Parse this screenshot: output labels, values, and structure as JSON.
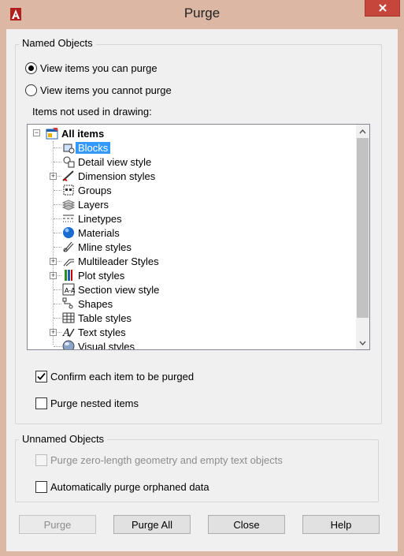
{
  "window": {
    "title": "Purge",
    "app_icon": "autocad-a-icon",
    "close_icon": "close-x-icon"
  },
  "named_objects": {
    "group_label": "Named Objects",
    "radio_can_purge": {
      "label": "View items you can purge",
      "selected": true
    },
    "radio_cannot_purge": {
      "label": "View items you cannot purge",
      "selected": false
    },
    "tree_label": "Items not used in drawing:",
    "tree": {
      "root": "All items",
      "items": [
        {
          "label": "Blocks",
          "icon": "blocks-icon",
          "expandable": false,
          "selected": true
        },
        {
          "label": "Detail view style",
          "icon": "detail-view-style-icon",
          "expandable": false,
          "selected": false
        },
        {
          "label": "Dimension styles",
          "icon": "dimension-styles-icon",
          "expandable": true,
          "selected": false
        },
        {
          "label": "Groups",
          "icon": "groups-icon",
          "expandable": false,
          "selected": false
        },
        {
          "label": "Layers",
          "icon": "layers-icon",
          "expandable": false,
          "selected": false
        },
        {
          "label": "Linetypes",
          "icon": "linetypes-icon",
          "expandable": false,
          "selected": false
        },
        {
          "label": "Materials",
          "icon": "materials-icon",
          "expandable": false,
          "selected": false
        },
        {
          "label": "Mline styles",
          "icon": "mline-styles-icon",
          "expandable": false,
          "selected": false
        },
        {
          "label": "Multileader Styles",
          "icon": "multileader-styles-icon",
          "expandable": true,
          "selected": false
        },
        {
          "label": "Plot styles",
          "icon": "plot-styles-icon",
          "expandable": true,
          "selected": false
        },
        {
          "label": "Section view style",
          "icon": "section-view-style-icon",
          "expandable": false,
          "selected": false
        },
        {
          "label": "Shapes",
          "icon": "shapes-icon",
          "expandable": false,
          "selected": false
        },
        {
          "label": "Table styles",
          "icon": "table-styles-icon",
          "expandable": false,
          "selected": false
        },
        {
          "label": "Text styles",
          "icon": "text-styles-icon",
          "expandable": true,
          "selected": false
        },
        {
          "label": "Visual styles",
          "icon": "visual-styles-icon",
          "expandable": false,
          "selected": false
        }
      ]
    },
    "confirm_each": {
      "label": "Confirm each item to be purged",
      "checked": true
    },
    "purge_nested": {
      "label": "Purge nested items",
      "checked": false
    }
  },
  "unnamed_objects": {
    "group_label": "Unnamed Objects",
    "zero_length": {
      "label": "Purge zero-length geometry and empty text objects",
      "checked": false,
      "enabled": false
    },
    "orphaned": {
      "label": "Automatically purge orphaned data",
      "checked": false
    }
  },
  "buttons": {
    "purge": {
      "label": "Purge",
      "enabled": false
    },
    "purge_all": {
      "label": "Purge All"
    },
    "close": {
      "label": "Close"
    },
    "help": {
      "label": "Help"
    }
  },
  "colors": {
    "title_bar": "#dcb7a4",
    "close_button": "#c7463b",
    "selection": "#3399ff",
    "dialog_bg": "#f0f0f0"
  }
}
